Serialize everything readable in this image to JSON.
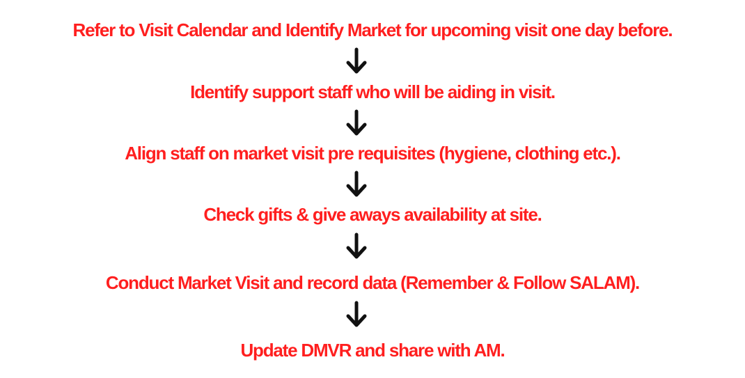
{
  "flowchart": {
    "steps": [
      "Refer to Visit Calendar and Identify Market for upcoming visit one day before.",
      "Identify support staff who will be aiding in visit.",
      "Align staff on market visit pre requisites (hygiene, clothing etc.).",
      "Check gifts & give aways availability at site.",
      "Conduct Market Visit and record data (Remember & Follow SALAM).",
      "Update DMVR and share with AM."
    ],
    "connector_icon": "down-arrow-icon",
    "colors": {
      "step_text": "#ff1f1f",
      "arrow": "#111111",
      "background": "#ffffff"
    }
  }
}
